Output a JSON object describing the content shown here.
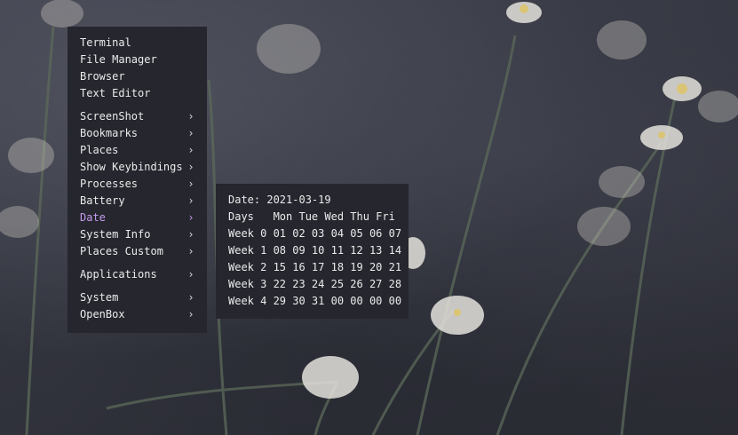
{
  "menu": {
    "items": [
      {
        "label": "Terminal",
        "submenu": false
      },
      {
        "label": "File Manager",
        "submenu": false
      },
      {
        "label": "Browser",
        "submenu": false
      },
      {
        "label": "Text Editor",
        "submenu": false
      },
      {
        "label": "ScreenShot",
        "submenu": true,
        "chevron": "›"
      },
      {
        "label": "Bookmarks",
        "submenu": true,
        "chevron": "›"
      },
      {
        "label": "Places",
        "submenu": true,
        "chevron": "›"
      },
      {
        "label": "Show Keybindings",
        "submenu": true,
        "chevron": "›"
      },
      {
        "label": "Processes",
        "submenu": true,
        "chevron": "›"
      },
      {
        "label": "Battery",
        "submenu": true,
        "chevron": "›"
      },
      {
        "label": "Date",
        "submenu": true,
        "chevron": "›",
        "active": true
      },
      {
        "label": "System Info",
        "submenu": true,
        "chevron": "›"
      },
      {
        "label": "Places Custom",
        "submenu": true,
        "chevron": "›"
      },
      {
        "label": "Applications",
        "submenu": true,
        "chevron": "›"
      },
      {
        "label": "System",
        "submenu": true,
        "chevron": "›"
      },
      {
        "label": "OpenBox",
        "submenu": true,
        "chevron": "›"
      }
    ]
  },
  "date_submenu": {
    "lines": [
      "Date: 2021-03-19",
      "Days   Mon Tue Wed Thu Fri",
      "Week 0 01 02 03 04 05 06 07",
      "Week 1 08 09 10 11 12 13 14",
      "Week 2 15 16 17 18 19 20 21",
      "Week 3 22 23 24 25 26 27 28",
      "Week 4 29 30 31 00 00 00 00"
    ]
  },
  "colors": {
    "menu_bg": "#25262e",
    "menu_text": "#ebebeb",
    "active_text": "#c69bf0"
  }
}
